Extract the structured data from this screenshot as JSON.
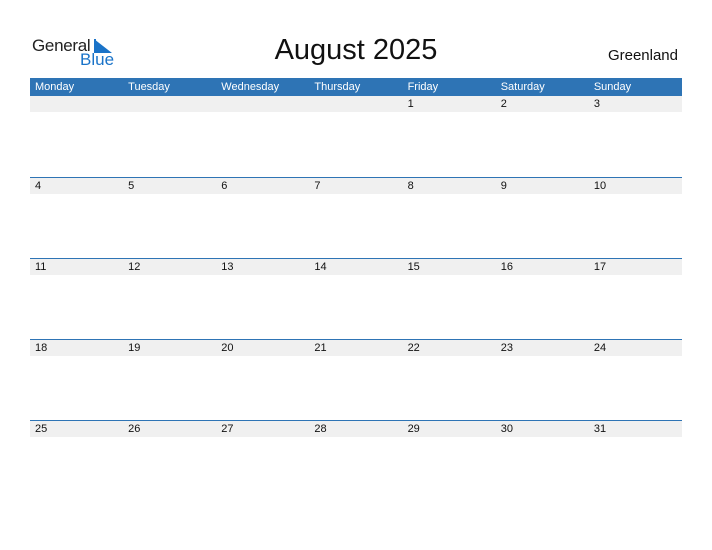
{
  "logo": {
    "line1": "General",
    "line2": "Blue"
  },
  "title": "August 2025",
  "region": "Greenland",
  "colors": {
    "accent": "#2e74b5",
    "daybar": "#f0f0f0"
  },
  "weekdays": [
    "Monday",
    "Tuesday",
    "Wednesday",
    "Thursday",
    "Friday",
    "Saturday",
    "Sunday"
  ],
  "weeks": [
    [
      "",
      "",
      "",
      "",
      "1",
      "2",
      "3"
    ],
    [
      "4",
      "5",
      "6",
      "7",
      "8",
      "9",
      "10"
    ],
    [
      "11",
      "12",
      "13",
      "14",
      "15",
      "16",
      "17"
    ],
    [
      "18",
      "19",
      "20",
      "21",
      "22",
      "23",
      "24"
    ],
    [
      "25",
      "26",
      "27",
      "28",
      "29",
      "30",
      "31"
    ]
  ]
}
